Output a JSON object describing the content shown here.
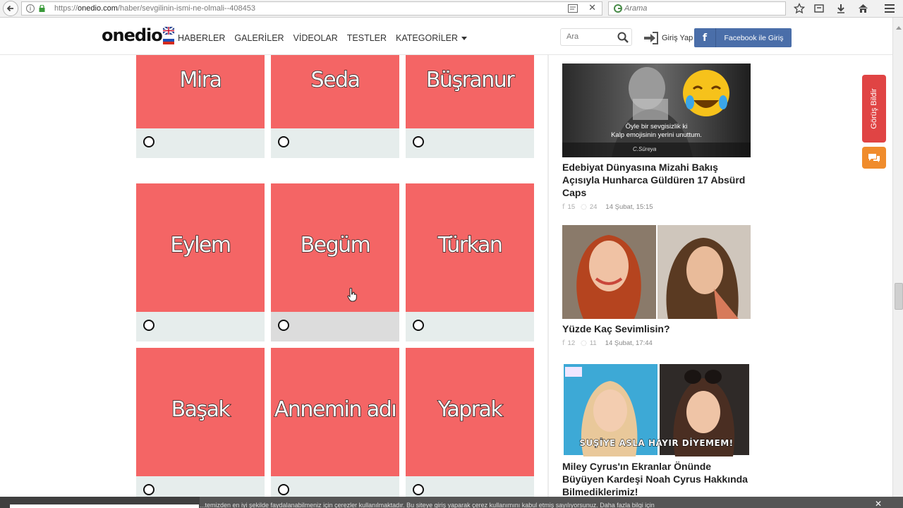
{
  "browser": {
    "url_prefix": "https://",
    "url_domain": "onedio.com",
    "url_path": "/haber/sevgilinin-ismi-ne-olmali--408453",
    "search_placeholder": "Arama"
  },
  "header": {
    "logo": "onedio",
    "nav": [
      {
        "label": "HABERLER"
      },
      {
        "label": "GALERİLER"
      },
      {
        "label": "VİDEOLAR"
      },
      {
        "label": "TESTLER"
      },
      {
        "label": "KATEGORİLER"
      }
    ],
    "search_placeholder": "Ara",
    "login_label": "Giriş Yap",
    "facebook_label": "Facebook ile Giriş"
  },
  "quiz": {
    "options": [
      {
        "name": "Mira"
      },
      {
        "name": "Seda"
      },
      {
        "name": "Büşranur"
      },
      {
        "name": "Eylem"
      },
      {
        "name": "Begüm"
      },
      {
        "name": "Türkan"
      },
      {
        "name": "Başak"
      },
      {
        "name": "Annemin adı"
      },
      {
        "name": "Yaprak"
      }
    ]
  },
  "sidebar": {
    "articles": [
      {
        "title": "Edebiyat Dünyasına Mizahi Bakış Açısıyla Hunharca Güldüren 17 Absürd Caps",
        "caption_line1": "Öyle bir sevgisizlik ki",
        "caption_line2": "Kalp emojisinin yerini unuttum.",
        "signature": "C.Süreya",
        "fb_count": "15",
        "wa_count": "24",
        "date": "14 Şubat, 15:15"
      },
      {
        "title": "Yüzde Kaç Sevimlisin?",
        "fb_count": "12",
        "wa_count": "11",
        "date": "14 Şubat, 17:44"
      },
      {
        "title": "Miley Cyrus'ın Ekranlar Önünde Büyüyen Kardeşi Noah Cyrus Hakkında Bilmediklerimiz!",
        "banner": "SUŞİYE ASLA HAYIR DİYEMEM!"
      }
    ]
  },
  "feedback_label": "Görüş Bildir",
  "cookie_text": "...temizden en iyi şekilde faydalanabilmeniz için çerezler kullanılmaktadır. Bu siteye giriş yaparak çerez kullanımını kabul etmiş sayılıyorsunuz.  Daha fazla bilgi için",
  "colors": {
    "tile": "#f46565",
    "option_bg": "#e6edec",
    "facebook": "#4a6ea9",
    "feedback": "#e04444",
    "chat": "#f08c2c"
  }
}
